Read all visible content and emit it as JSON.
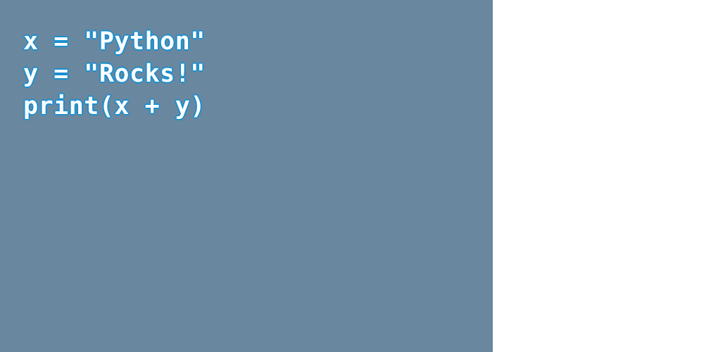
{
  "code": {
    "lines": [
      "x = \"Python\"",
      "y = \"Rocks!\"",
      "print(x + y)"
    ]
  },
  "colors": {
    "panel_background": "#69879f",
    "text": "#ffffff",
    "text_outline": "#1a8fd0",
    "page_background": "#ffffff"
  }
}
